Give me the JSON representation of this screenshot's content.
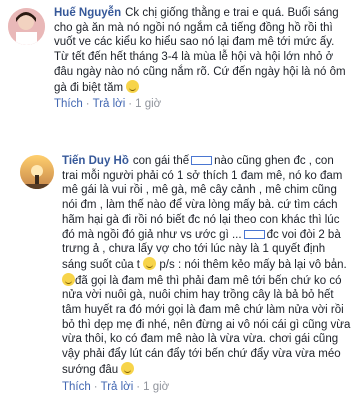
{
  "comments": [
    {
      "author": "Huế Nguyễn",
      "text": "Ck chị giống thằng e trai e quá. Buổi sáng cho gà ăn mà nó ngồi nó ngắm cả tiếng đồng hồ rồi thì vuốt ve các kiểu ko hiểu sao nó lại đam mê tới mức ấy. Từ tết đến hết tháng 3-4 là mùa lễ hội và hội lớn nhỏ ở đâu ngày nào nó cũng nắm rõ. Cứ đến ngày hội là nó ôm gà đi biệt tăm",
      "emoji": "smile-emoji",
      "actions": {
        "like": "Thích",
        "reply": "Trả lời",
        "time": "1 giờ"
      }
    },
    {
      "author": "Tiến Duy Hồ",
      "text_a": "con gái thế",
      "text_b": "nào cũng ghen đc , con trai mỗi người phải có 1 sở thích 1 đam mê, nó ko đam mê gái là vui rồi , mê gà, mê cây cảnh , mê chim cũng nói đm , làm thế nào để vừa lòng mấy bà. cứ tìm cách hãm hại gà đi rồi nó biết đc nó lại theo con khác thì lúc đó mà ngồi đó giả như vs ước gì ...",
      "text_c": "đc voi đòi 2 bà trưng ả , chưa lấy vợ cho tới lúc này là 1 quyết định sáng suốt của t",
      "text_d": "p/s : nói thêm kẻo mấy bà lại vô ba̓n.",
      "text_e": "đã gọi là đam mê thì phải đam mê tới bến chứ ko có nửa vời nuôi gà, nuôi chim hay trồng cây là bả bỏ hết tâm huyết ra đó mới gọi là đam mê chứ làm nửa vời rồi bỏ thì dẹp mẹ đi nhé, nên đừng ai vô nói cái gì cũng vừa vừa thôi, ko có đam mê nào là vừa vừa. chơi gái cũng vậy phải đẩy lút cán đẩy tới bến chứ đẩy vừa vừa méo sướng đâu",
      "emoji": "smile-emoji",
      "actions": {
        "like": "Thích",
        "reply": "Trả lời",
        "time": "1 giờ"
      }
    }
  ],
  "colors": {
    "link": "#4267b2",
    "author": "#365899",
    "muted": "#90949c",
    "text": "#1d2129"
  }
}
